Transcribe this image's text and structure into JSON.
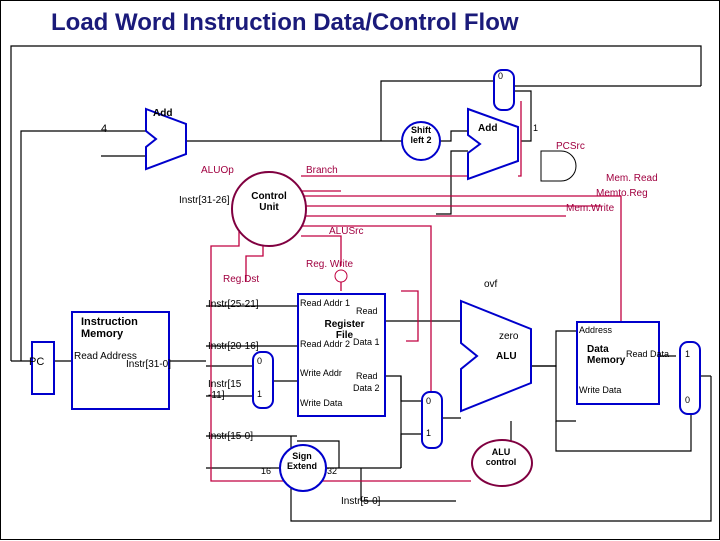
{
  "title": "Load Word Instruction Data/Control Flow",
  "const4": "4",
  "add1": "Add",
  "add2": "Add",
  "shiftLeft": "Shift\nleft 2",
  "pcsrc": "PCSrc",
  "mux0a": "0",
  "mux1a": "1",
  "aluop": "ALUOp",
  "branch": "Branch",
  "memRead": "Mem. Read",
  "memtoReg": "Memto.Reg",
  "memWrite": "Mem.Write",
  "instr31_26": "Instr[31-26]",
  "controlUnit": "Control\nUnit",
  "alusrc": "ALUSrc",
  "regWrite": "Reg. Write",
  "regDst": "Reg.Dst",
  "pc": "PC",
  "instrMem": "Instruction\nMemory",
  "readAddress": "Read\nAddress",
  "instr31_0": "Instr[31-0]",
  "instr25_21": "Instr[25-21]",
  "instr20_16": "Instr[20-16]",
  "instr15_11": "Instr[15\n-11]",
  "instr15_0": "Instr[15-0]",
  "instr5_0": "Instr[5-0]",
  "readAddr1": "Read Addr 1",
  "readAddr2": "Read Addr 2",
  "writeAddr": "Write Addr",
  "writeData": "Write Data",
  "read": "Read",
  "data1": "Data 1",
  "data2": "Data 2",
  "registerFile": "Register\nFile",
  "signExtend": "Sign\nExtend",
  "se16": "16",
  "se32": "32",
  "ovf": "ovf",
  "zero": "zero",
  "alu": "ALU",
  "aluControl": "ALU\ncontrol",
  "dataMem": "Data\nMemory",
  "address": "Address",
  "readData": "Read Data",
  "writeData2": "Write Data",
  "mux0b": "0",
  "mux1b": "1",
  "mux0c": "0",
  "mux1c": "1",
  "mux0d": "0",
  "mux1d": "1"
}
